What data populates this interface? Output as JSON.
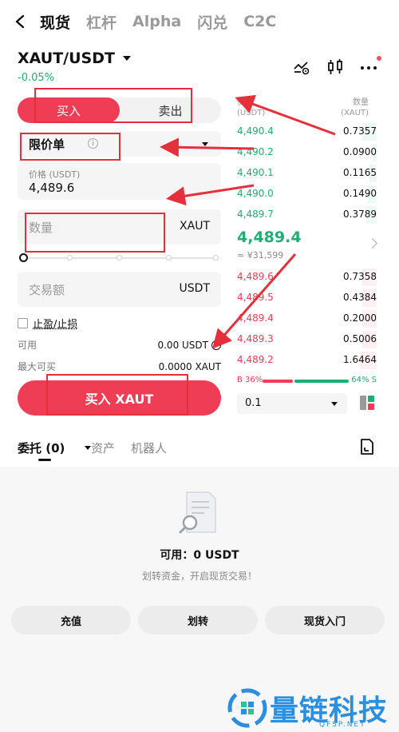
{
  "nav": {
    "tabs": [
      "现货",
      "杠杆",
      "Alpha",
      "闪兑",
      "C2C"
    ],
    "active": 0
  },
  "pair": {
    "symbol": "XAUT/USDT",
    "change": "-0.05%"
  },
  "form": {
    "buy_label": "买入",
    "sell_label": "卖出",
    "order_type": "限价单",
    "info_glyph": "i",
    "price_caption": "价格 (USDT)",
    "price_value": "4,489.6",
    "qty_placeholder": "数量",
    "qty_unit": "XAUT",
    "amount_placeholder": "交易额",
    "amount_unit": "USDT",
    "tpsl_label": "止盈/止损",
    "available_label": "可用",
    "available_value": "0.00 USDT",
    "max_buy_label": "最大可买",
    "max_buy_value": "0.0000 XAUT",
    "buy_button": "买入 XAUT"
  },
  "orderbook": {
    "price_header": "价\n(USDT)",
    "qty_header": "数量\n(XAUT)",
    "asks": [
      {
        "price": "4,490.4",
        "qty": "0.7357",
        "depth": 0.1
      },
      {
        "price": "4,490.2",
        "qty": "0.0900",
        "depth": 0.03
      },
      {
        "price": "4,490.1",
        "qty": "0.1165",
        "depth": 0.05
      },
      {
        "price": "4,490.0",
        "qty": "0.1490",
        "depth": 0.06
      },
      {
        "price": "4,489.7",
        "qty": "0.3789",
        "depth": 0.08
      }
    ],
    "mid_price": "4,489.4",
    "mid_fiat": "≈ ¥31,599",
    "bids": [
      {
        "price": "4,489.6",
        "qty": "0.7358",
        "depth": 0.1
      },
      {
        "price": "4,489.5",
        "qty": "0.4384",
        "depth": 0.1
      },
      {
        "price": "4,489.4",
        "qty": "0.2000",
        "depth": 0.1
      },
      {
        "price": "4,489.3",
        "qty": "0.5006",
        "depth": 0.1
      },
      {
        "price": "4,489.2",
        "qty": "1.6464",
        "depth": 0.12
      }
    ],
    "buy_ratio": "B 36%",
    "sell_ratio": "64% S",
    "depth_value": "0.1"
  },
  "bottom_tabs": {
    "orders": "委托 (0)",
    "assets": "资产",
    "bot": "机器人"
  },
  "empty": {
    "available": "可用：0 USDT",
    "hint": "划转资金，开启现货交易！",
    "buttons": [
      "充值",
      "划转",
      "现货入门"
    ]
  },
  "watermark": {
    "title": "量链科技",
    "sub": "QFSP.NET"
  },
  "colors": {
    "buy": "#ef3d55",
    "sell": "#1eae71",
    "annotation": "#e5303b",
    "watermark": "#2b8fe0"
  }
}
